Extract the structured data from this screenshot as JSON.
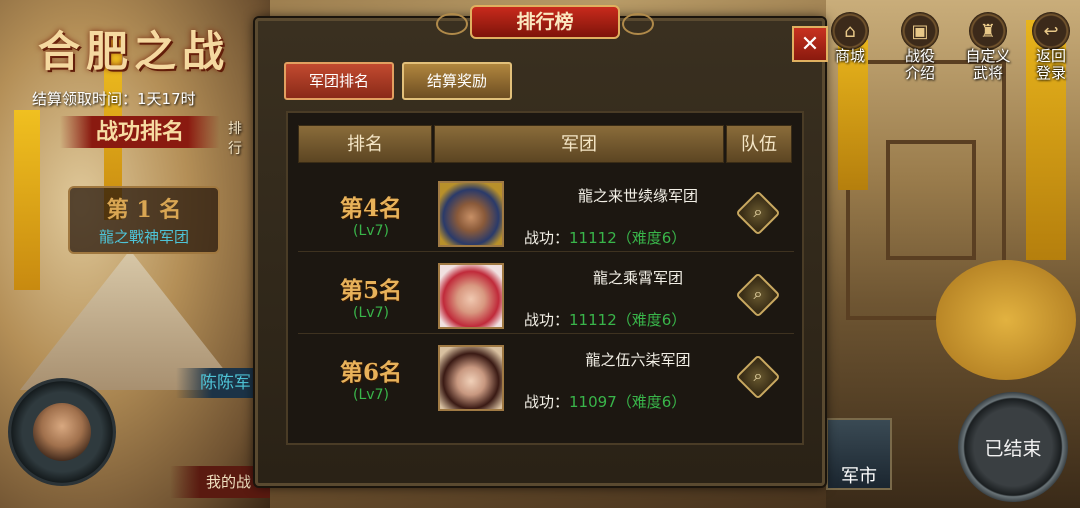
{
  "background": {
    "event_title": "合肥之战",
    "settle_time": "结算领取时间：1天17时",
    "rank_banner": "战功排名",
    "side_tab": "排行",
    "first_place": {
      "rank": "第 1 名",
      "corps": "龍之戰神军团"
    },
    "player_name_fragment": "陈陈军",
    "my_fragment": "我的战",
    "market_fragment": "军市",
    "ended_button": "已结束"
  },
  "right_menu": [
    {
      "label": "商城",
      "icon": "shop-icon"
    },
    {
      "label": "战役\n介绍",
      "icon": "campaign-info-icon"
    },
    {
      "label": "自定义\n武将",
      "icon": "custom-general-icon"
    },
    {
      "label": "返回\n登录",
      "icon": "return-login-icon"
    }
  ],
  "modal": {
    "title": "排行榜",
    "close_label": "✕",
    "tabs": [
      {
        "label": "军团排名",
        "active": true
      },
      {
        "label": "结算奖励",
        "active": false
      }
    ],
    "columns": [
      "排名",
      "军团",
      "队伍"
    ],
    "merit_label": "战功：",
    "rows": [
      {
        "rank": "第4名",
        "level": "(Lv7)",
        "corps": "龍之来世续缘军团",
        "merit": "11112",
        "difficulty": "（难度6）",
        "portrait": "armored-general-portrait"
      },
      {
        "rank": "第5名",
        "level": "(Lv7)",
        "corps": "龍之乘霄军团",
        "merit": "11112",
        "difficulty": "（难度6）",
        "portrait": "female-warrior-portrait"
      },
      {
        "rank": "第6名",
        "level": "(Lv7)",
        "corps": "龍之伍六柒军团",
        "merit": "11097",
        "difficulty": "（难度6）",
        "portrait": "noble-lady-portrait"
      }
    ]
  },
  "colors": {
    "accent_red": "#8a1a10",
    "rank_gold": "#e8b25a",
    "level_green": "#39b54a",
    "corps_cyan": "#4ec3d6"
  }
}
